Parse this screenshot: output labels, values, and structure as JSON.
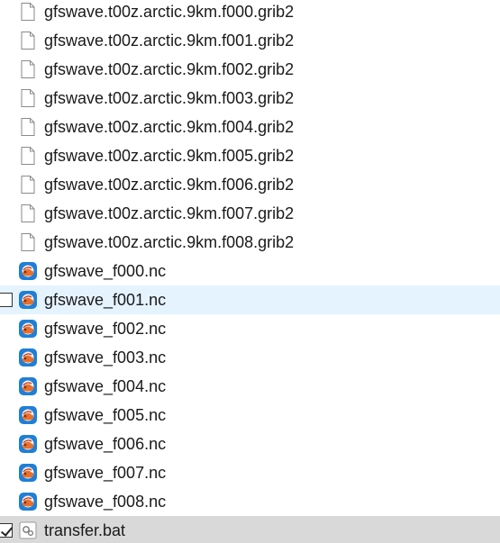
{
  "files": [
    {
      "name": "gfswave.t00z.arctic.9km.f000.grib2",
      "icon": "document-icon",
      "state": "normal",
      "checked": false
    },
    {
      "name": "gfswave.t00z.arctic.9km.f001.grib2",
      "icon": "document-icon",
      "state": "normal",
      "checked": false
    },
    {
      "name": "gfswave.t00z.arctic.9km.f002.grib2",
      "icon": "document-icon",
      "state": "normal",
      "checked": false
    },
    {
      "name": "gfswave.t00z.arctic.9km.f003.grib2",
      "icon": "document-icon",
      "state": "normal",
      "checked": false
    },
    {
      "name": "gfswave.t00z.arctic.9km.f004.grib2",
      "icon": "document-icon",
      "state": "normal",
      "checked": false
    },
    {
      "name": "gfswave.t00z.arctic.9km.f005.grib2",
      "icon": "document-icon",
      "state": "normal",
      "checked": false
    },
    {
      "name": "gfswave.t00z.arctic.9km.f006.grib2",
      "icon": "document-icon",
      "state": "normal",
      "checked": false
    },
    {
      "name": "gfswave.t00z.arctic.9km.f007.grib2",
      "icon": "document-icon",
      "state": "normal",
      "checked": false
    },
    {
      "name": "gfswave.t00z.arctic.9km.f008.grib2",
      "icon": "document-icon",
      "state": "normal",
      "checked": false
    },
    {
      "name": "gfswave_f000.nc",
      "icon": "netcdf-app-icon",
      "state": "normal",
      "checked": false
    },
    {
      "name": "gfswave_f001.nc",
      "icon": "netcdf-app-icon",
      "state": "hover",
      "checked": false
    },
    {
      "name": "gfswave_f002.nc",
      "icon": "netcdf-app-icon",
      "state": "normal",
      "checked": false
    },
    {
      "name": "gfswave_f003.nc",
      "icon": "netcdf-app-icon",
      "state": "normal",
      "checked": false
    },
    {
      "name": "gfswave_f004.nc",
      "icon": "netcdf-app-icon",
      "state": "normal",
      "checked": false
    },
    {
      "name": "gfswave_f005.nc",
      "icon": "netcdf-app-icon",
      "state": "normal",
      "checked": false
    },
    {
      "name": "gfswave_f006.nc",
      "icon": "netcdf-app-icon",
      "state": "normal",
      "checked": false
    },
    {
      "name": "gfswave_f007.nc",
      "icon": "netcdf-app-icon",
      "state": "normal",
      "checked": false
    },
    {
      "name": "gfswave_f008.nc",
      "icon": "netcdf-app-icon",
      "state": "normal",
      "checked": false
    },
    {
      "name": "transfer.bat",
      "icon": "batch-file-icon",
      "state": "selected",
      "checked": true
    }
  ],
  "colors": {
    "hover_row": "#e5f3ff",
    "selected_row": "#d9d9d9",
    "text": "#1a1a1a",
    "nc_icon_blue": "#1f7fd6",
    "nc_icon_orange": "#e8702a"
  }
}
